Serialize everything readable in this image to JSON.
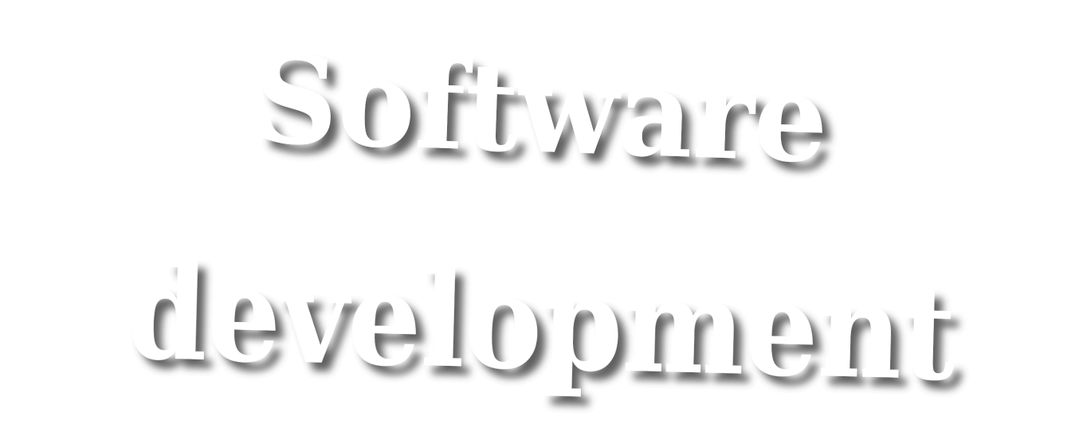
{
  "wordart": {
    "line1": "Software",
    "line2": "development",
    "text_color": "#ffffff",
    "shadow_color": "#555555",
    "background_color": "#ffffff"
  }
}
